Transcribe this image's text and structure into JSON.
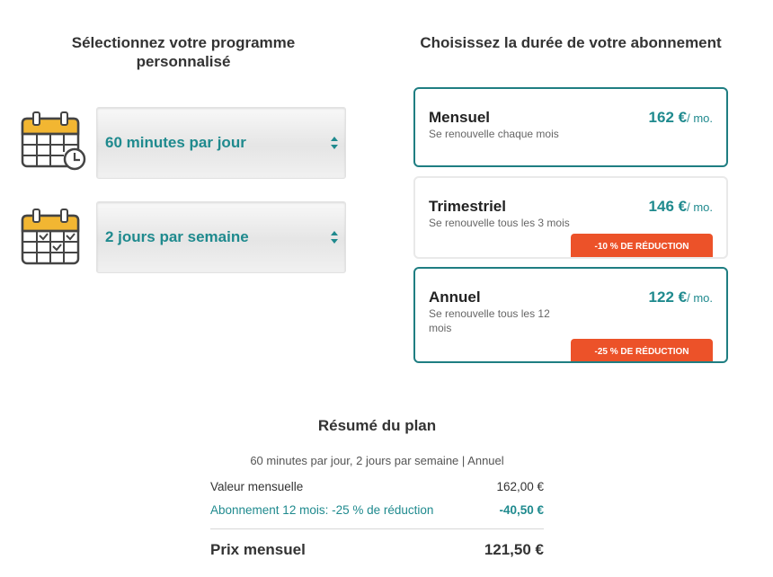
{
  "left": {
    "heading": "Sélectionnez votre programme personnalisé",
    "selects": [
      {
        "value": "60 minutes par jour",
        "icon": "calendar-clock-icon"
      },
      {
        "value": "2 jours par semaine",
        "icon": "calendar-check-icon"
      }
    ]
  },
  "right": {
    "heading": "Choisissez la durée de votre abonnement",
    "plans": [
      {
        "name": "Mensuel",
        "desc": "Se renouvelle chaque mois",
        "price": "162 €",
        "unit": "/ mo.",
        "badge": "",
        "selected": true
      },
      {
        "name": "Trimestriel",
        "desc": "Se renouvelle tous les 3 mois",
        "price": "146 €",
        "unit": "/ mo.",
        "badge": "-10 % DE RÉDUCTION",
        "selected": false
      },
      {
        "name": "Annuel",
        "desc": "Se renouvelle tous les 12 mois",
        "price": "122 €",
        "unit": "/ mo.",
        "badge": "-25 % DE RÉDUCTION",
        "selected": true
      }
    ]
  },
  "summary": {
    "title": "Résumé du plan",
    "desc": "60 minutes par jour, 2 jours par semaine | Annuel",
    "monthly_label": "Valeur mensuelle",
    "monthly_value": "162,00 €",
    "discount_label": "Abonnement 12 mois: -25 % de réduction",
    "discount_value": "-40,50 €",
    "total_label": "Prix mensuel",
    "total_value": "121,50 €"
  },
  "colors": {
    "accent": "#1f8a8e",
    "border_selected": "#1f7e82",
    "badge": "#ec5229",
    "calendar_top": "#f2b632"
  }
}
